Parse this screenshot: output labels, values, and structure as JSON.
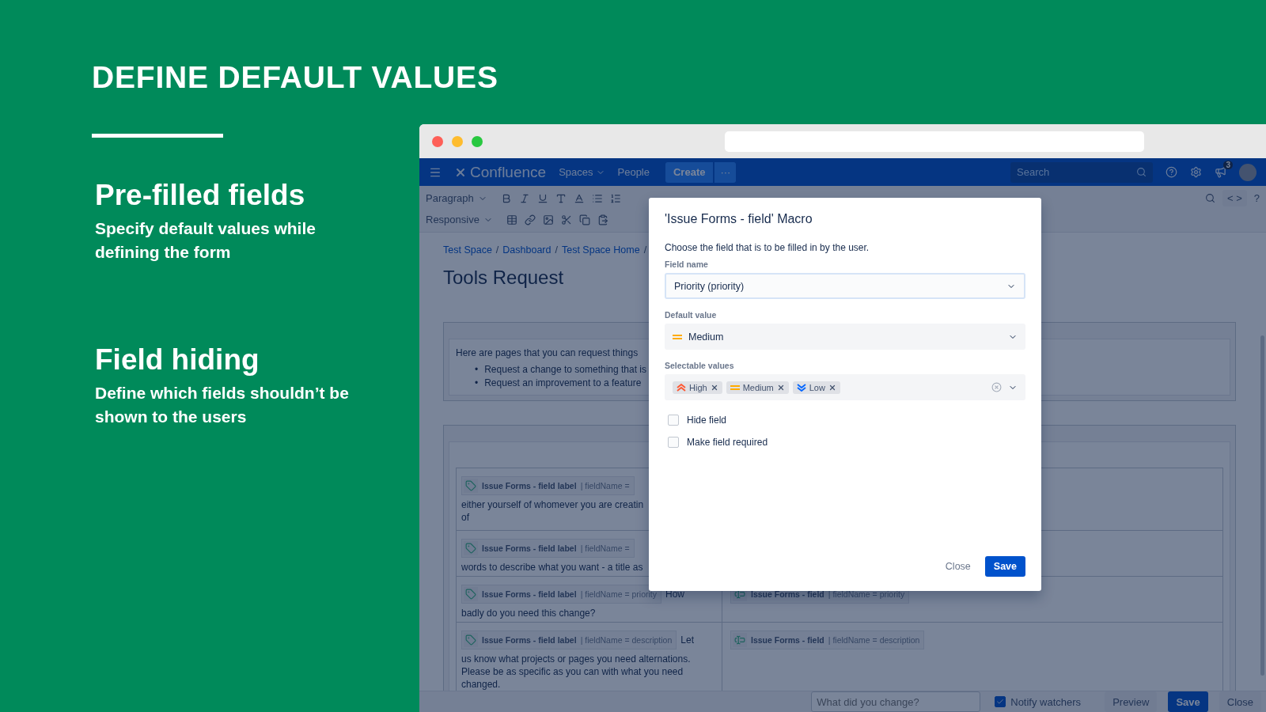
{
  "slide": {
    "headline": "DEFINE DEFAULT VALUES",
    "features": [
      {
        "title": "Pre-filled fields",
        "description": "Specify default values while defining the form"
      },
      {
        "title": "Field hiding",
        "description": "Define which fields shouldn’t be shown to the users"
      }
    ]
  },
  "browser": {
    "nav": {
      "logo": "Confluence",
      "menus": [
        {
          "label": "Spaces",
          "dropdown": true
        },
        {
          "label": "People",
          "dropdown": false
        }
      ],
      "create": "Create",
      "more": "···",
      "search_placeholder": "Search",
      "notification_count": "3"
    },
    "toolbar": {
      "paragraph_style": "Paragraph",
      "layout": "Responsive",
      "source": "< >",
      "help": "?"
    },
    "breadcrumbs": [
      "Test Space",
      "Dashboard",
      "Test Space Home"
    ],
    "breadcrumb_separator": "/",
    "page_title": "Tools Request",
    "intro": {
      "text": "Here are pages that you can request things",
      "bullet": "•",
      "bullets": [
        "Request a change to something that is",
        "Request an improvement to a feature"
      ]
    },
    "form_rows": [
      {
        "macro": "Issue Forms - field label",
        "param": "| fieldName =",
        "text": "either yourself of whomever you are creatin",
        "more": "of"
      },
      {
        "macro": "Issue Forms - field label",
        "param": "| fieldName =",
        "text": "words to describe what you want - a title as"
      },
      {
        "macro": "Issue Forms - field label",
        "param": "| fieldName = priority",
        "lead": "How",
        "text": "badly do you need this change?",
        "field": {
          "macro": "Issue Forms - field",
          "param": "| fieldName = priority"
        }
      },
      {
        "macro": "Issue Forms - field label",
        "param": "| fieldName = description",
        "lead": "Let",
        "text": "us know what projects or pages you need alternations. Please be as specific as you can with what you need changed.",
        "field": {
          "macro": "Issue Forms - field",
          "param": "| fieldName = description"
        }
      }
    ],
    "bottom_bar": {
      "placeholder": "What did you change?",
      "notify_label": "Notify watchers",
      "notify_checked": true,
      "preview": "Preview",
      "save": "Save",
      "close": "Close"
    }
  },
  "dialog": {
    "title": "'Issue Forms - field' Macro",
    "description": "Choose the field that is to be filled in by the user.",
    "field_name": {
      "label": "Field name",
      "value": "Priority (priority)"
    },
    "default_value": {
      "label": "Default value",
      "value": "Medium",
      "kind": "medium"
    },
    "selectable_values": {
      "label": "Selectable values",
      "tags": [
        {
          "label": "High",
          "kind": "high"
        },
        {
          "label": "Medium",
          "kind": "medium"
        },
        {
          "label": "Low",
          "kind": "low"
        }
      ]
    },
    "checkboxes": [
      {
        "label": "Hide field",
        "checked": false
      },
      {
        "label": "Make field required",
        "checked": false
      }
    ],
    "close": "Close",
    "save": "Save"
  }
}
